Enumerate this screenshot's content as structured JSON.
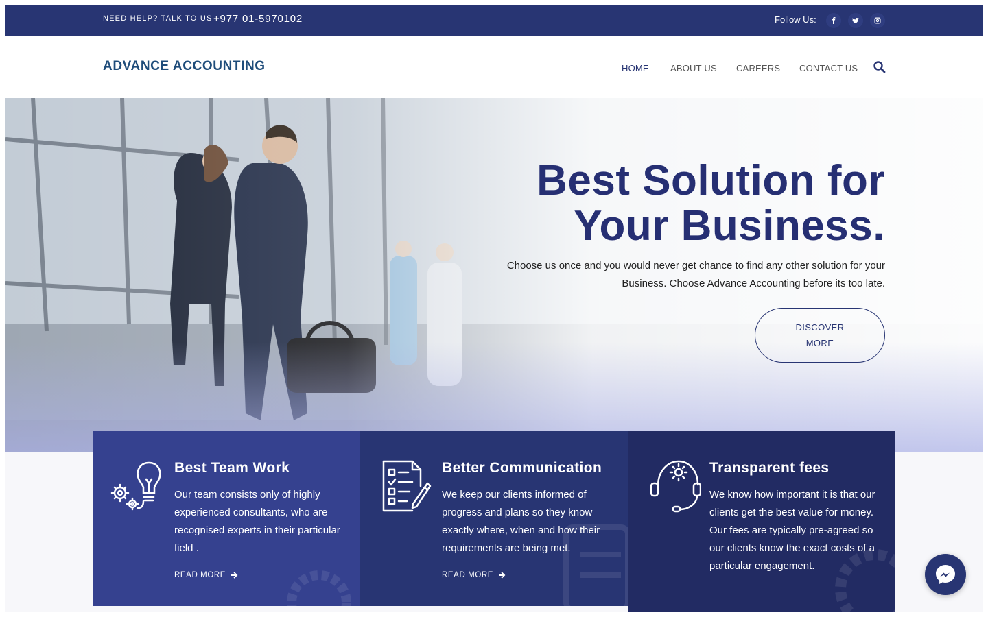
{
  "topbar": {
    "help_text": "NEED HELP? TALK TO US",
    "phone": "+977 01-5970102",
    "follow_label": "Follow Us:",
    "social": [
      "facebook-icon",
      "twitter-icon",
      "instagram-icon"
    ]
  },
  "header": {
    "logo": "ADVANCE ACCOUNTING",
    "nav": [
      "HOME",
      "ABOUT US",
      "CAREERS",
      "CONTACT US"
    ],
    "active_nav": "HOME"
  },
  "hero": {
    "title_line1": "Best Solution for",
    "title_line2": "Your Business.",
    "subtitle": "Choose us once and you would never get chance to find any other solution for your Business. Choose Advance Accounting before its too late.",
    "button_line1": "DISCOVER",
    "button_line2": "MORE"
  },
  "features": [
    {
      "title": "Best Team Work",
      "text": "Our team consists only of highly experienced consultants, who are recognised experts in their particular field .",
      "link": "READ MORE",
      "icon": "lightbulb-gears-icon"
    },
    {
      "title": "Better Communication",
      "text": "We keep our clients informed of progress and plans so they know exactly where, when and how their requirements are being met.",
      "link": "READ MORE",
      "icon": "checklist-icon"
    },
    {
      "title": "Transparent fees",
      "text": "We know how important it is that our clients get the best value for money. Our fees are typically pre-agreed so our clients know the exact costs of a particular engagement.",
      "link": "",
      "icon": "headset-gear-icon"
    }
  ],
  "colors": {
    "primary": "#283573",
    "card1": "#35418f",
    "card2": "#283573",
    "card3": "#222b63"
  }
}
